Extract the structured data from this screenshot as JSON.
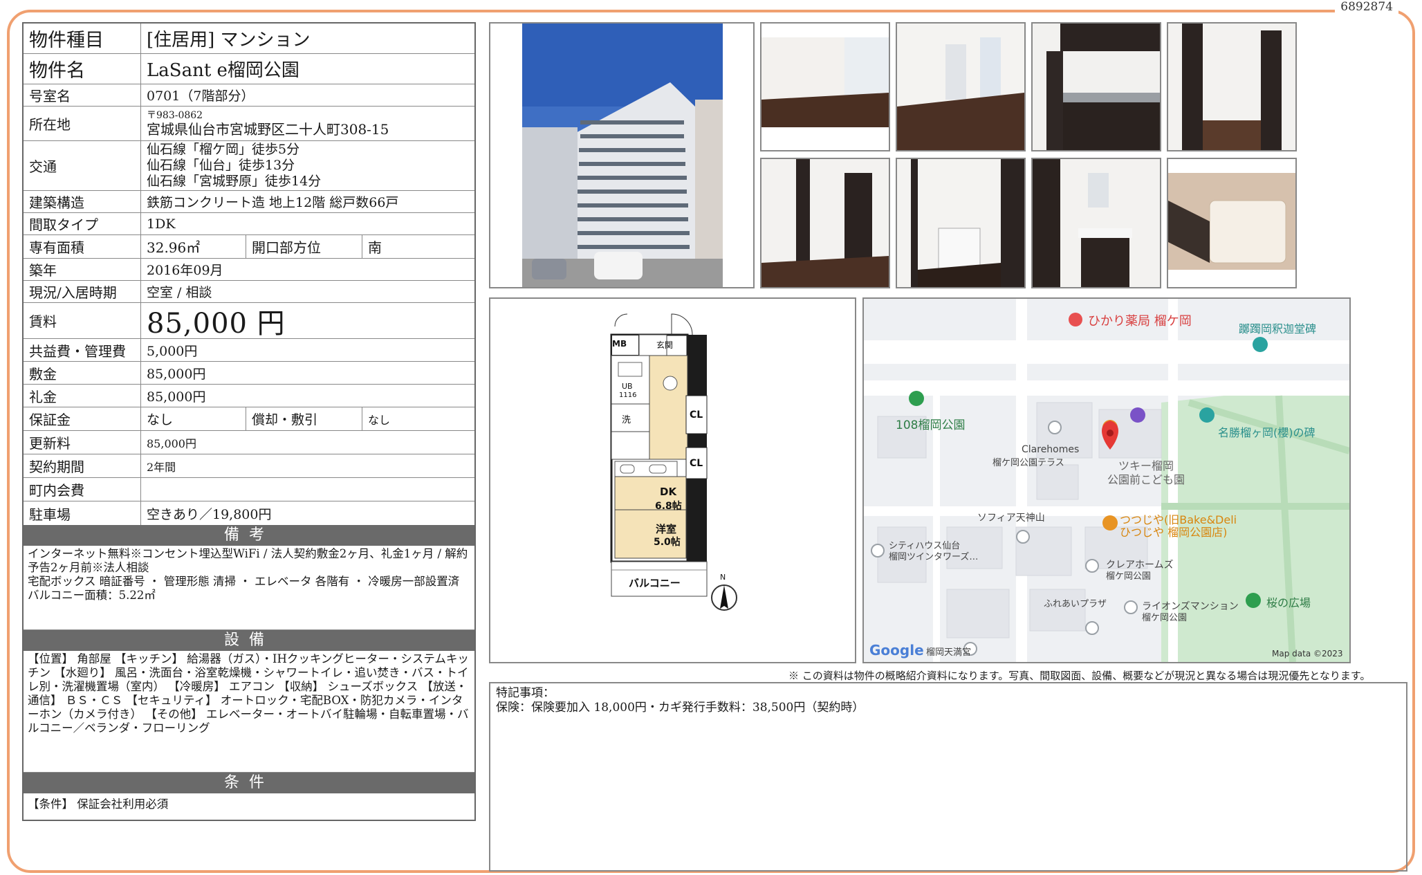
{
  "doc_id": "6892874",
  "spec": {
    "type_label": "物件種目",
    "type_value": "[住居用] マンション",
    "name_label": "物件名",
    "name_value": "LaSant e榴岡公園",
    "room_label": "号室名",
    "room_value": "0701（7階部分）",
    "address_label": "所在地",
    "postal": "〒983-0862",
    "address": "宮城県仙台市宮城野区二十人町308-15",
    "access_label": "交通",
    "access": [
      "仙石線「榴ケ岡」徒歩5分",
      "仙石線「仙台」徒歩13分",
      "仙石線「宮城野原」徒歩14分"
    ],
    "structure_label": "建築構造",
    "structure_value": "鉄筋コンクリート造 地上12階 総戸数66戸",
    "layout_label": "間取タイプ",
    "layout_value": "1DK",
    "area_label": "専有面積",
    "area_value": "32.96㎡",
    "direction_label": "開口部方位",
    "direction_value": "南",
    "built_label": "築年",
    "built_value": "2016年09月",
    "status_label": "現況/入居時期",
    "status_value": "空室 / 相談",
    "rent_label": "賃料",
    "rent_value": "85,000 円",
    "fee_label": "共益費・管理費",
    "fee_value": "5,000円",
    "deposit_label": "敷金",
    "deposit_value": "85,000円",
    "key_money_label": "礼金",
    "key_money_value": "85,000円",
    "guarantee_label": "保証金",
    "guarantee_value": "なし",
    "amort_label": "償却・敷引",
    "amort_value": "なし",
    "renewal_label": "更新料",
    "renewal_value": "85,000円",
    "contract_label": "契約期間",
    "contract_value": "2年間",
    "town_label": "町内会費",
    "town_value": "",
    "parking_label": "駐車場",
    "parking_value": "空きあり／19,800円"
  },
  "remarks_band": "備考",
  "remarks_text": "インターネット無料※コンセント埋込型WiFi / 法人契約敷金2ヶ月、礼金1ヶ月 / 解約予告2ヶ月前※法人相談\n宅配ボックス 暗証番号 ・ 管理形態 清掃 ・ エレベータ 各階有 ・ 冷暖房一部設置済\nバルコニー面積：5.22㎡",
  "equipment_band": "設備",
  "equipment_text": "【位置】 角部屋 【キッチン】 給湯器（ガス）・IHクッキングヒーター・システムキッチン 【水廻り】 風呂・洗面台・浴室乾燥機・シャワートイレ・追い焚き・バス・トイレ別・洗濯機置場（室内） 【冷暖房】 エアコン 【収納】 シューズボックス 【放送・通信】 ＢＳ・ＣＳ 【セキュリティ】 オートロック・宅配BOX・防犯カメラ・インターホン（カメラ付き） 【その他】 エレベーター・オートバイ駐輪場・自転車置場・バルコニー／ベランダ・フローリング",
  "conditions_band": "条件",
  "conditions_text": "【条件】 保証会社利用必須",
  "floorplan": {
    "mb": "MB",
    "entrance": "玄関",
    "ub": "UB",
    "ub_size": "1116",
    "wash": "洗",
    "cl1": "CL",
    "cl2": "CL",
    "dk": "DK",
    "dk_size": "6.8帖",
    "western": "洋室",
    "western_size": "5.0帖",
    "balcony": "バルコニー",
    "north": "N"
  },
  "map": {
    "pharmacy": "ひかり薬局 榴ケ岡",
    "monument1": "躑躅岡釈迦堂碑",
    "park": "108榴岡公園",
    "monument2": "名勝榴ヶ岡(櫻)の碑",
    "clarehomes": "Clarehomes",
    "clarehomes2": "榴ケ岡公園テラス",
    "kindergarten": "ツキー榴岡",
    "kindergarten2": "公園前こども園",
    "sophia": "ソフィア天神山",
    "tsutsujiya": "つつじや(旧Bake&Deli",
    "tsutsujiya2": "ひつじや 榴岡公園店)",
    "cityhouse": "シティハウス仙台",
    "cityhouse2": "榴岡ツインタワーズ…",
    "clairhomes_jp": "クレアホームズ",
    "clairhomes_jp2": "榴ケ岡公園",
    "sakura": "桜の広場",
    "fureai": "ふれあいプラザ",
    "lions": "ライオンズマンション",
    "lions2": "榴ケ岡公園",
    "tenmangu": "榴岡天満宮",
    "google": "Google",
    "mapdata": "Map data ©2023"
  },
  "disclaimer": "※ この資料は物件の概略紹介資料になります。写真、間取図面、設備、概要などが現況と異なる場合は現況優先となります。",
  "special_title": "特記事項：",
  "special_text": "保険：保険要加入 18,000円・カギ発行手数料：38,500円（契約時）"
}
